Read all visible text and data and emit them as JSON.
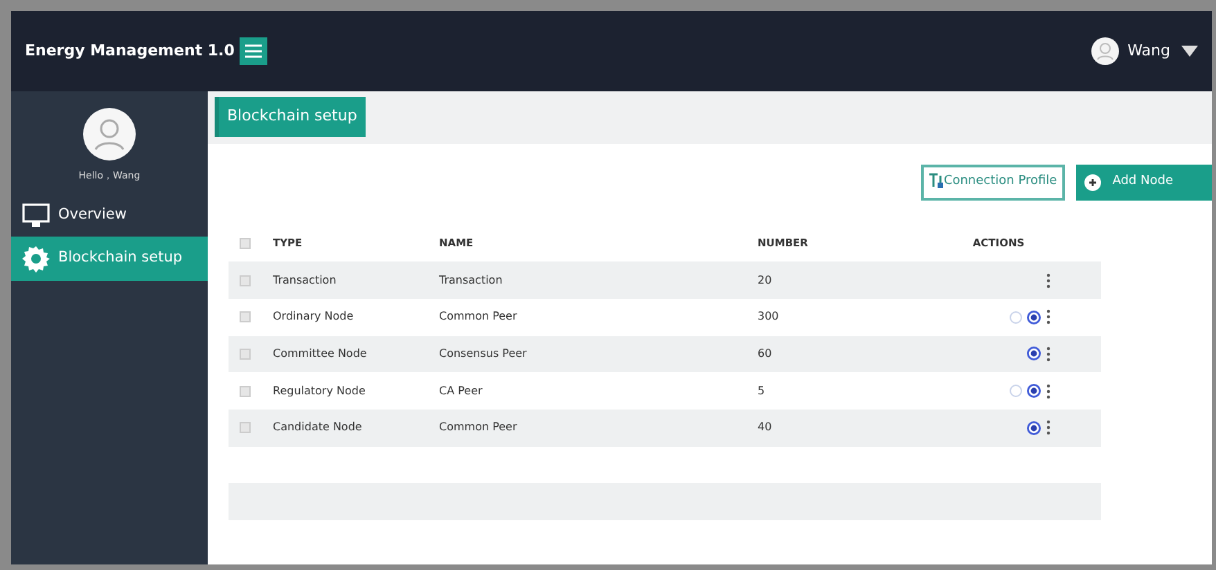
{
  "app": {
    "title": "Energy Management 1.0",
    "user": "Wang"
  },
  "sidebar": {
    "greeting": "Hello，Wang",
    "items": [
      {
        "label": "Overview",
        "selected": false
      },
      {
        "label": "Blockchain setup",
        "selected": true
      }
    ]
  },
  "page": {
    "title": "Blockchain setup"
  },
  "toolbar": {
    "buttons": [
      {
        "label": "Connection Profile",
        "kind": "outline"
      },
      {
        "label": "Add Node",
        "kind": "primary"
      }
    ]
  },
  "table": {
    "all_checked": false,
    "columns": [
      "TYPE",
      "NAME",
      "NUMBER",
      "ACTIONS"
    ],
    "rows": [
      {
        "checked": false,
        "type": "Transaction",
        "name": "Transaction",
        "number": "20",
        "option_circle": false,
        "radio": false
      },
      {
        "checked": false,
        "type": "Ordinary Node",
        "name": "Common Peer",
        "number": "300",
        "option_circle": true,
        "radio": true
      },
      {
        "checked": false,
        "type": "Committee Node",
        "name": "Consensus Peer",
        "number": "60",
        "option_circle": false,
        "radio": true
      },
      {
        "checked": false,
        "type": "Regulatory Node",
        "name": "CA Peer",
        "number": "5",
        "option_circle": true,
        "radio": true
      },
      {
        "checked": false,
        "type": "Candidate Node",
        "name": "Common Peer",
        "number": "40",
        "option_circle": false,
        "radio": true
      }
    ]
  }
}
